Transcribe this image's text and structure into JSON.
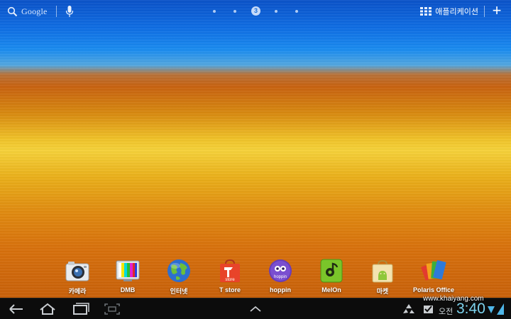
{
  "topbar": {
    "search_label": "Google",
    "page_indicator_current": "3",
    "apps_label": "애플리케이션",
    "add_label": "+"
  },
  "dock": {
    "apps": [
      {
        "label": "카메라",
        "icon": "camera-icon"
      },
      {
        "label": "DMB",
        "icon": "dmb-tv-icon"
      },
      {
        "label": "인터넷",
        "icon": "globe-icon"
      },
      {
        "label": "T store",
        "icon": "tstore-bag-icon"
      },
      {
        "label": "hoppin",
        "icon": "hoppin-icon"
      },
      {
        "label": "MelOn",
        "icon": "melon-icon"
      },
      {
        "label": "마켓",
        "icon": "market-bag-icon"
      },
      {
        "label": "Polaris Office",
        "icon": "polaris-office-icon"
      }
    ]
  },
  "statusbar": {
    "ampm": "오전",
    "time": "3:40",
    "watermark": "www.khaiyang.com"
  },
  "colors": {
    "clock": "#7dd3ee",
    "sky": "#0f6ee4",
    "gold": "#f6d23a"
  }
}
